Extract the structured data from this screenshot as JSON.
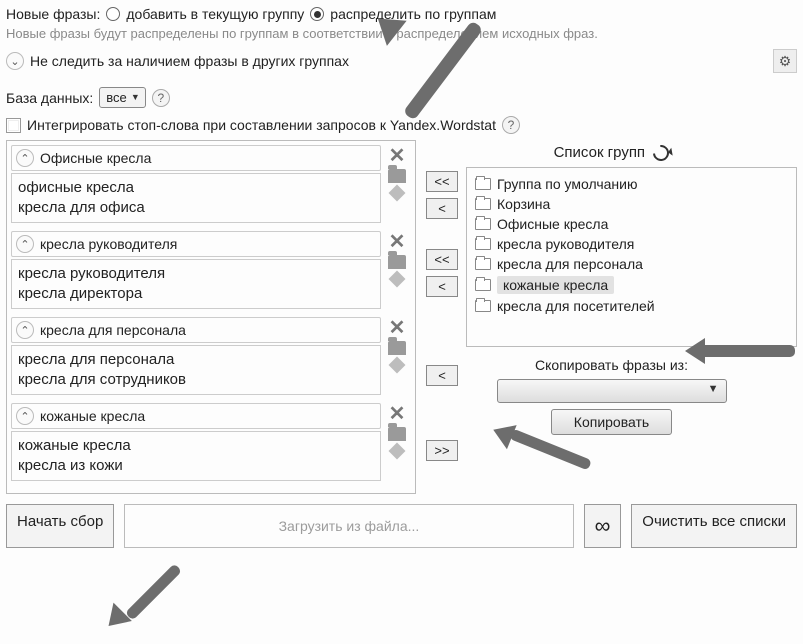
{
  "top": {
    "new_phrases_label": "Новые фразы:",
    "radio_add_current": "добавить в текущую группу",
    "radio_distribute": "распределить по группам",
    "hint": "Новые фразы будут распределены по группам в соответствии с распределением исходных фраз.",
    "dont_track": "Не следить за наличием фразы в других группах"
  },
  "db": {
    "label": "База данных:",
    "value": "все"
  },
  "integrate": "Интегрировать стоп-слова при составлении запросов к Yandex.Wordstat",
  "groups_left": [
    {
      "title": "Офисные кресла",
      "phrases": "офисные  кресла\nкресла для офиса"
    },
    {
      "title": "кресла руководителя",
      "phrases": "кресла руководителя\nкресла директора"
    },
    {
      "title": "кресла для персонала",
      "phrases": "кресла для персонала\nкресла для сотрудников"
    },
    {
      "title": "кожаные кресла",
      "phrases": "кожаные кресла\nкресла из кожи"
    }
  ],
  "right": {
    "list_title": "Список групп",
    "items": [
      "Группа по умолчанию",
      "Корзина",
      "Офисные кресла",
      "кресла руководителя",
      "кресла для персонала",
      "кожаные кресла",
      "кресла для посетителей"
    ],
    "selected_index": 5,
    "copy_label": "Скопировать фразы из:",
    "copy_btn": "Копировать"
  },
  "move": {
    "dlt": "<<",
    "lt": "<",
    "gt": ">>"
  },
  "bottom": {
    "start": "Начать сбор",
    "load": "Загрузить из файла...",
    "clear": "Очистить все списки"
  }
}
